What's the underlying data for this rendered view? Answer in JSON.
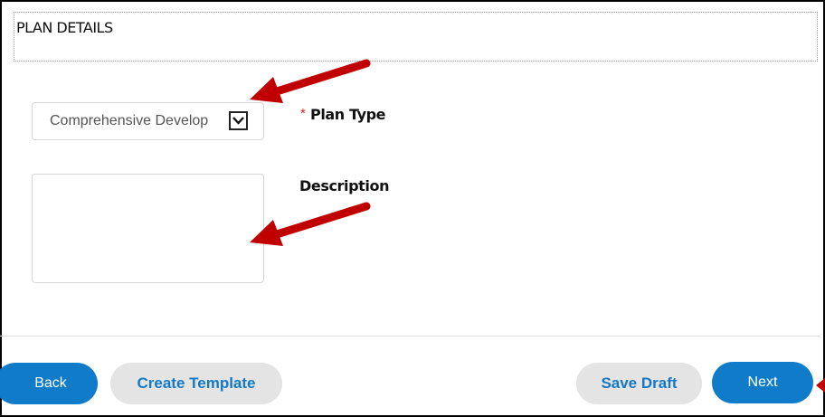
{
  "section": {
    "title": "PLAN DETAILS"
  },
  "form": {
    "plan_type": {
      "selected_value": "Comprehensive Develop",
      "required_marker": "*",
      "label": "Plan Type"
    },
    "description": {
      "label": "Description",
      "value": ""
    }
  },
  "buttons": {
    "back": "Back",
    "create_template": "Create Template",
    "save_draft": "Save Draft",
    "next": "Next"
  },
  "annotations": {
    "arrow_color": "#c00000"
  },
  "colors": {
    "primary_button": "#0f7bc9",
    "secondary_button": "#e4e4e4",
    "secondary_text": "#1578c4",
    "required": "#d62b1f"
  },
  "icons": {
    "dropdown": "chevron-down-icon",
    "annotation": "red-arrow-icon"
  }
}
